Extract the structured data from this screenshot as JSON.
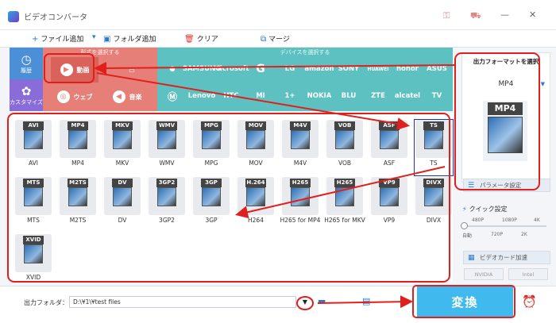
{
  "app": {
    "title": "ビデオコンバータ"
  },
  "toolbar": {
    "add_file": "ファイル追加",
    "add_folder": "フォルダ追加",
    "clear": "クリア",
    "merge": "マージ"
  },
  "side": {
    "history": "履歴",
    "customize": "カスタマイズ"
  },
  "format_group": {
    "title": "形式を選択する",
    "video": "動画",
    "web": "ウェブ",
    "audio": "音楽"
  },
  "device_group": {
    "title": "デバイスを選択する"
  },
  "brands_row1": [
    "",
    "SAMSUNG",
    "Microsoft",
    "G",
    "LG",
    "amazon",
    "SONY",
    "HUAWEI",
    "honor",
    "ASUS"
  ],
  "brands_row2": [
    "",
    "Lenovo",
    "HTC",
    "MI",
    "1+",
    "NOKIA",
    "BLU",
    "ZTE",
    "alcatel",
    "TV"
  ],
  "formats": [
    {
      "tag": "AVI",
      "label": "AVI"
    },
    {
      "tag": "MP4",
      "label": "MP4"
    },
    {
      "tag": "MKV",
      "label": "MKV"
    },
    {
      "tag": "WMV",
      "label": "WMV"
    },
    {
      "tag": "MPG",
      "label": "MPG"
    },
    {
      "tag": "MOV",
      "label": "MOV"
    },
    {
      "tag": "M4V",
      "label": "M4V"
    },
    {
      "tag": "VOB",
      "label": "VOB"
    },
    {
      "tag": "ASF",
      "label": "ASF"
    },
    {
      "tag": "TS",
      "label": "TS"
    },
    {
      "tag": "MTS",
      "label": "MTS"
    },
    {
      "tag": "M2TS",
      "label": "M2TS"
    },
    {
      "tag": "DV",
      "label": "DV"
    },
    {
      "tag": "3GP2",
      "label": "3GP2"
    },
    {
      "tag": "3GP",
      "label": "3GP"
    },
    {
      "tag": "H.264",
      "label": "H264"
    },
    {
      "tag": "H265",
      "label": "H265 for MP4"
    },
    {
      "tag": "H265",
      "label": "H265 for MKV"
    },
    {
      "tag": "VP9",
      "label": "VP9"
    },
    {
      "tag": "DIVX",
      "label": "DIVX"
    },
    {
      "tag": "XVID",
      "label": "XVID"
    }
  ],
  "output": {
    "header": "出力フォーマットを選択",
    "format": "MP4",
    "big_tag": "MP4"
  },
  "params": {
    "param_settings": "パラメータ設定",
    "quick_settings": "クイック設定",
    "ticks_top": [
      "480P",
      "1080P",
      "4K"
    ],
    "ticks_bottom": [
      "自動",
      "720P",
      "2K"
    ],
    "gpu": "ビデオカード加速",
    "nvidia": "NVIDIA",
    "intel": "Intel"
  },
  "bottom": {
    "folder_label": "出力フォルダ：",
    "folder_path": "D:\\¥1\\¥test files",
    "convert": "変換"
  },
  "colors": {
    "accent": "#3fb9ee",
    "annotation": "#e0201c",
    "category_red": "#e67f78",
    "category_teal": "#5cc1c0"
  }
}
